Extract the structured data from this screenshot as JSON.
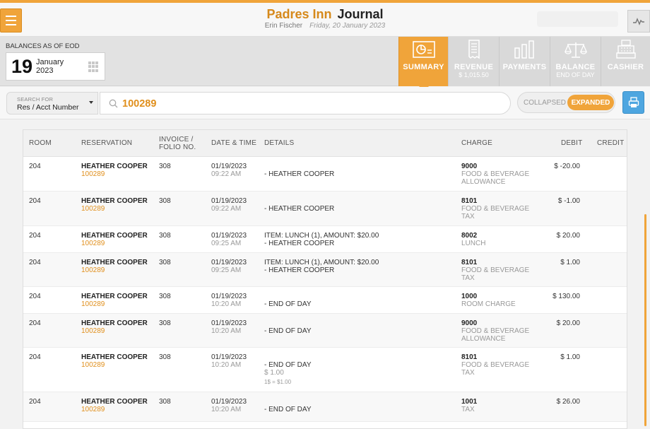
{
  "header": {
    "hotel_name": "Padres Inn",
    "page_title": "Journal",
    "user": "Erin Fischer",
    "date": "Friday, 20 January 2023"
  },
  "balance_date": {
    "label": "BALANCES AS OF EOD",
    "day": "19",
    "month": "January",
    "year": "2023"
  },
  "tabs": [
    {
      "label": "SUMMARY",
      "sub": "",
      "icon": "chart-icon",
      "active": true
    },
    {
      "label": "REVENUE",
      "sub": "$ 1,015.50",
      "icon": "receipt-icon",
      "active": false
    },
    {
      "label": "PAYMENTS",
      "sub": "",
      "icon": "bars-icon",
      "active": false
    },
    {
      "label": "BALANCE",
      "sub": "END OF DAY",
      "icon": "scale-icon",
      "active": false
    },
    {
      "label": "CASHIER",
      "sub": "",
      "icon": "cash-register-icon",
      "active": false
    }
  ],
  "search": {
    "field_caption": "SEARCH FOR",
    "field_value": "Res / Acct Number",
    "query": "100289",
    "collapsed_label": "COLLAPSED",
    "expanded_label": "EXPANDED"
  },
  "columns": {
    "room": "ROOM",
    "reservation": "RESERVATION",
    "invoice": "INVOICE /",
    "invoice2": "FOLIO NO.",
    "datetime": "DATE & TIME",
    "details": "DETAILS",
    "charge": "CHARGE",
    "debit": "DEBIT",
    "credit": "CREDIT"
  },
  "rows": [
    {
      "room": "204",
      "name": "HEATHER COOPER",
      "res": "100289",
      "invoice": "308",
      "date": "01/19/2023",
      "time": "09:22 AM",
      "detail1": "",
      "detail2": "- HEATHER COOPER",
      "note": "",
      "note2": "",
      "code": "9000",
      "charge1": "FOOD & BEVERAGE",
      "charge2": "ALLOWANCE",
      "debit": "$ -20.00",
      "credit": ""
    },
    {
      "room": "204",
      "name": "HEATHER COOPER",
      "res": "100289",
      "invoice": "308",
      "date": "01/19/2023",
      "time": "09:22 AM",
      "detail1": "",
      "detail2": "- HEATHER COOPER",
      "note": "",
      "note2": "",
      "code": "8101",
      "charge1": "FOOD & BEVERAGE",
      "charge2": "TAX",
      "debit": "$ -1.00",
      "credit": ""
    },
    {
      "room": "204",
      "name": "HEATHER COOPER",
      "res": "100289",
      "invoice": "308",
      "date": "01/19/2023",
      "time": "09:25 AM",
      "detail1": "ITEM: LUNCH (1), AMOUNT: $20.00",
      "detail2": "- HEATHER COOPER",
      "note": "",
      "note2": "",
      "code": "8002",
      "charge1": "LUNCH",
      "charge2": "",
      "debit": "$ 20.00",
      "credit": ""
    },
    {
      "room": "204",
      "name": "HEATHER COOPER",
      "res": "100289",
      "invoice": "308",
      "date": "01/19/2023",
      "time": "09:25 AM",
      "detail1": "ITEM: LUNCH (1), AMOUNT: $20.00",
      "detail2": "- HEATHER COOPER",
      "note": "",
      "note2": "",
      "code": "8101",
      "charge1": "FOOD & BEVERAGE",
      "charge2": "TAX",
      "debit": "$ 1.00",
      "credit": ""
    },
    {
      "room": "204",
      "name": "HEATHER COOPER",
      "res": "100289",
      "invoice": "308",
      "date": "01/19/2023",
      "time": "10:20 AM",
      "detail1": "",
      "detail2": "- END OF DAY",
      "note": "",
      "note2": "",
      "code": "1000",
      "charge1": "ROOM CHARGE",
      "charge2": "",
      "debit": "$ 130.00",
      "credit": ""
    },
    {
      "room": "204",
      "name": "HEATHER COOPER",
      "res": "100289",
      "invoice": "308",
      "date": "01/19/2023",
      "time": "10:20 AM",
      "detail1": "",
      "detail2": "- END OF DAY",
      "note": "",
      "note2": "",
      "code": "9000",
      "charge1": "FOOD & BEVERAGE",
      "charge2": "ALLOWANCE",
      "debit": "$ 20.00",
      "credit": ""
    },
    {
      "room": "204",
      "name": "HEATHER COOPER",
      "res": "100289",
      "invoice": "308",
      "date": "01/19/2023",
      "time": "10:20 AM",
      "detail1": "",
      "detail2": "- END OF DAY",
      "note": "$ 1.00",
      "note2": "1$ = $1.00",
      "code": "8101",
      "charge1": "FOOD & BEVERAGE",
      "charge2": "TAX",
      "debit": "$ 1.00",
      "credit": ""
    },
    {
      "room": "204",
      "name": "HEATHER COOPER",
      "res": "100289",
      "invoice": "308",
      "date": "01/19/2023",
      "time": "10:20 AM",
      "detail1": "",
      "detail2": "- END OF DAY",
      "note": "",
      "note2": "",
      "code": "1001",
      "charge1": "TAX",
      "charge2": "",
      "debit": "$ 26.00",
      "credit": ""
    }
  ],
  "colors": {
    "accent": "#f0a43a",
    "accent_text": "#e08f1c",
    "print_button": "#4ea6e0"
  }
}
